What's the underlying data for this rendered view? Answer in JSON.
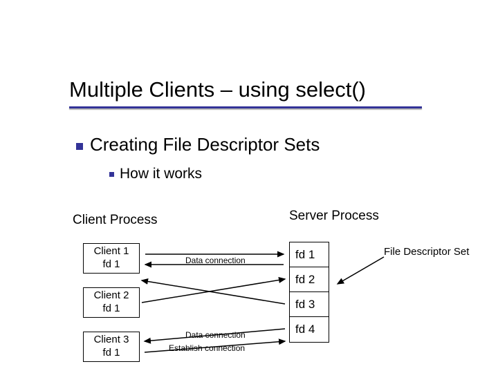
{
  "title": "Multiple Clients – using select()",
  "bullets": {
    "level1": "Creating File Descriptor Sets",
    "level2": "How it works"
  },
  "labels": {
    "client_process": "Client Process",
    "server_process": "Server Process",
    "fd_set": "File Descriptor Set",
    "data_connection": "Data connection",
    "establish_connection": "Establish connection"
  },
  "clients": [
    {
      "name": "Client 1",
      "fd": "fd 1"
    },
    {
      "name": "Client 2",
      "fd": "fd 1"
    },
    {
      "name": "Client 3",
      "fd": "fd 1"
    }
  ],
  "fd_table": [
    "fd 1",
    "fd 2",
    "fd 3",
    "fd 4"
  ]
}
